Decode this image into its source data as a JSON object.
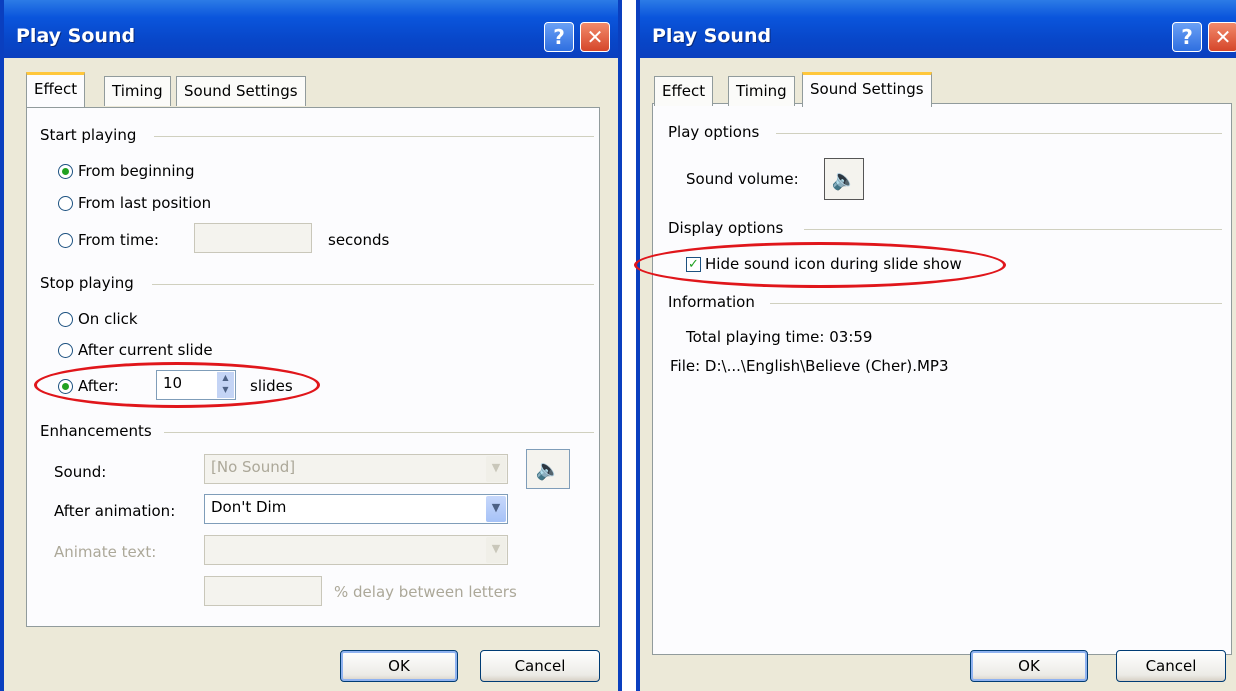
{
  "left": {
    "title": "Play Sound",
    "tabs": [
      "Effect",
      "Timing",
      "Sound Settings"
    ],
    "start_playing": {
      "label": "Start playing",
      "from_beginning": "From beginning",
      "from_last": "From last position",
      "from_time": "From time:",
      "seconds": "seconds"
    },
    "stop_playing": {
      "label": "Stop playing",
      "on_click": "On click",
      "after_current": "After current slide",
      "after": "After:",
      "after_value": "10",
      "slides": "slides"
    },
    "enhancements": {
      "label": "Enhancements",
      "sound_label": "Sound:",
      "sound_value": "[No Sound]",
      "after_animation_label": "After animation:",
      "after_animation_value": "Don't Dim",
      "animate_text_label": "Animate text:",
      "delay_label": "% delay between letters"
    },
    "ok": "OK",
    "cancel": "Cancel"
  },
  "right": {
    "title": "Play Sound",
    "tabs": [
      "Effect",
      "Timing",
      "Sound Settings"
    ],
    "play_options_label": "Play options",
    "sound_volume_label": "Sound volume:",
    "display_options_label": "Display options",
    "hide_icon_label": "Hide sound icon during slide show",
    "information_label": "Information",
    "total_playing_time": "Total playing time:  03:59",
    "file": "File:  D:\\...\\English\\Believe (Cher).MP3",
    "ok": "OK",
    "cancel": "Cancel"
  },
  "colors": {
    "titlebar": "#0a55dc",
    "dialog_bg": "#ece9d8",
    "highlight": "#e0161b",
    "radio_dot": "#21a121"
  },
  "icons": [
    "help-icon",
    "close-icon",
    "speaker-icon"
  ]
}
